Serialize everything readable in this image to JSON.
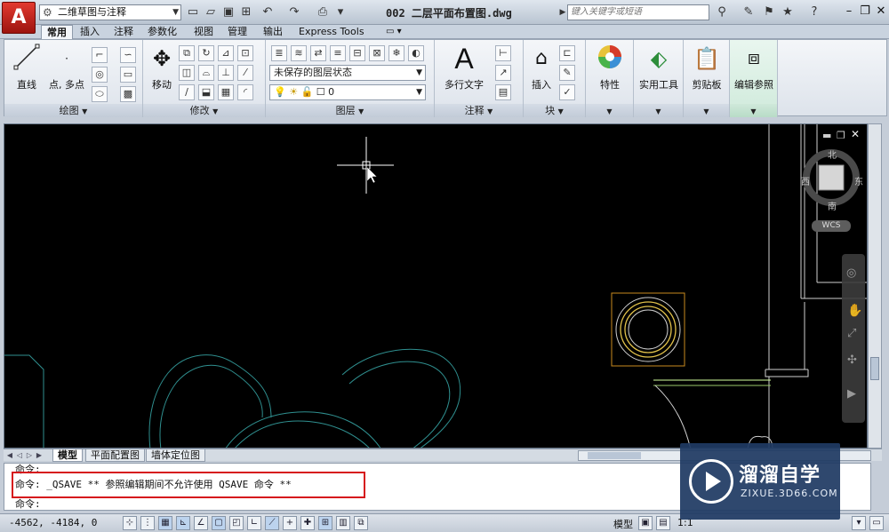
{
  "title_bar": {
    "app_button": "A",
    "workspace": "二维草图与注释",
    "document_title": "002 二层平面布置图.dwg",
    "search_placeholder": "键入关键字或短语"
  },
  "ribbon_tabs": [
    {
      "label": "常用",
      "active": true
    },
    {
      "label": "插入"
    },
    {
      "label": "注释"
    },
    {
      "label": "参数化"
    },
    {
      "label": "视图"
    },
    {
      "label": "管理"
    },
    {
      "label": "输出"
    },
    {
      "label": "Express Tools"
    }
  ],
  "panels": {
    "draw": {
      "title": "绘图",
      "line_label": "直线",
      "point_label": "点, 多点"
    },
    "modify": {
      "title": "修改",
      "move_label": "移动"
    },
    "layers": {
      "title": "图层",
      "layer_state": "未保存的图层状态",
      "current_layer": "0"
    },
    "annotation": {
      "title": "注释",
      "mtext_label": "多行文字",
      "mtext_glyph": "A"
    },
    "block": {
      "title": "块",
      "insert_label": "插入"
    },
    "properties": {
      "label": "特性"
    },
    "utilities": {
      "label": "实用工具"
    },
    "clipboard": {
      "label": "剪贴板"
    },
    "refedit": {
      "label": "编辑参照"
    }
  },
  "viewcube": {
    "north": "北",
    "south": "南",
    "east": "东",
    "west": "西",
    "wcs": "WCS"
  },
  "layout_tabs": [
    {
      "label": "模型",
      "active": true
    },
    {
      "label": "平面配置图"
    },
    {
      "label": "墙体定位图"
    }
  ],
  "command_lines": [
    "命令:",
    "命令: _QSAVE ** 参照编辑期间不允许使用 QSAVE 命令 **",
    "命令:"
  ],
  "status": {
    "coordinates": "-4562, -4184, 0",
    "model": "模型",
    "scale": "1:1"
  },
  "watermark": {
    "title": "溜溜自学",
    "url": "ZIXUE.3D66.COM"
  },
  "colors": {
    "canvas": "#000000",
    "cyan_lines": "#2f8f8f",
    "selection_orange": "#c98a1e",
    "accent_red": "#d6181c",
    "ref_green": "#d6f0e4"
  }
}
